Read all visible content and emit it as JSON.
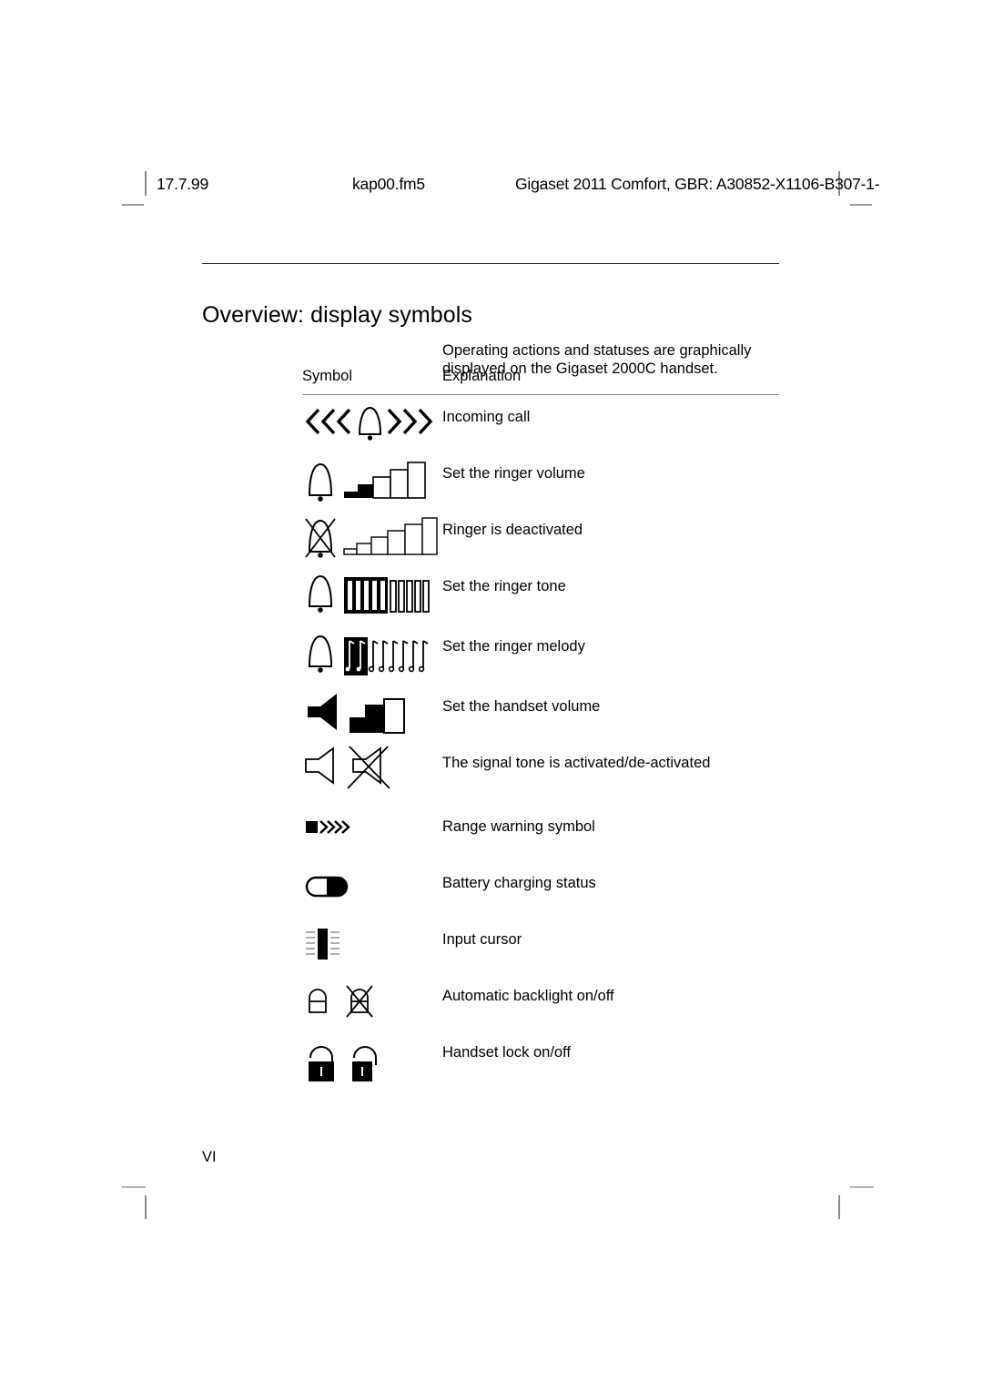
{
  "header": {
    "date": "17.7.99",
    "filename": "kap00.fm5",
    "document": "Gigaset 2011 Comfort, GBR: A30852-X1106-B307-1-"
  },
  "title": "Overview: display symbols",
  "intro": "Operating actions and statuses are graphically displayed on the Gigaset 2000C handset.",
  "table": {
    "columns": [
      "Symbol",
      "Explanation"
    ],
    "rows": [
      {
        "symbol": "incoming-call",
        "explanation": "Incoming call"
      },
      {
        "symbol": "ringer-volume",
        "explanation": "Set the ringer volume"
      },
      {
        "symbol": "ringer-off",
        "explanation": "Ringer is deactivated"
      },
      {
        "symbol": "ringer-tone",
        "explanation": "Set the ringer tone"
      },
      {
        "symbol": "ringer-melody",
        "explanation": "Set the ringer melody"
      },
      {
        "symbol": "handset-volume",
        "explanation": "Set the handset volume"
      },
      {
        "symbol": "signal-tone",
        "explanation": "The signal tone is activated/de-activated"
      },
      {
        "symbol": "range-warning",
        "explanation": "Range warning symbol"
      },
      {
        "symbol": "battery",
        "explanation": "Battery charging status"
      },
      {
        "symbol": "input-cursor",
        "explanation": "Input cursor"
      },
      {
        "symbol": "backlight",
        "explanation": "Automatic backlight on/off"
      },
      {
        "symbol": "handset-lock",
        "explanation": "Handset lock on/off"
      }
    ]
  },
  "folio": "VI",
  "colors": {
    "ink": "#000000",
    "rule": "#8c8c8c",
    "crop_mark": "#9a9a9a",
    "paper": "#ffffff"
  }
}
